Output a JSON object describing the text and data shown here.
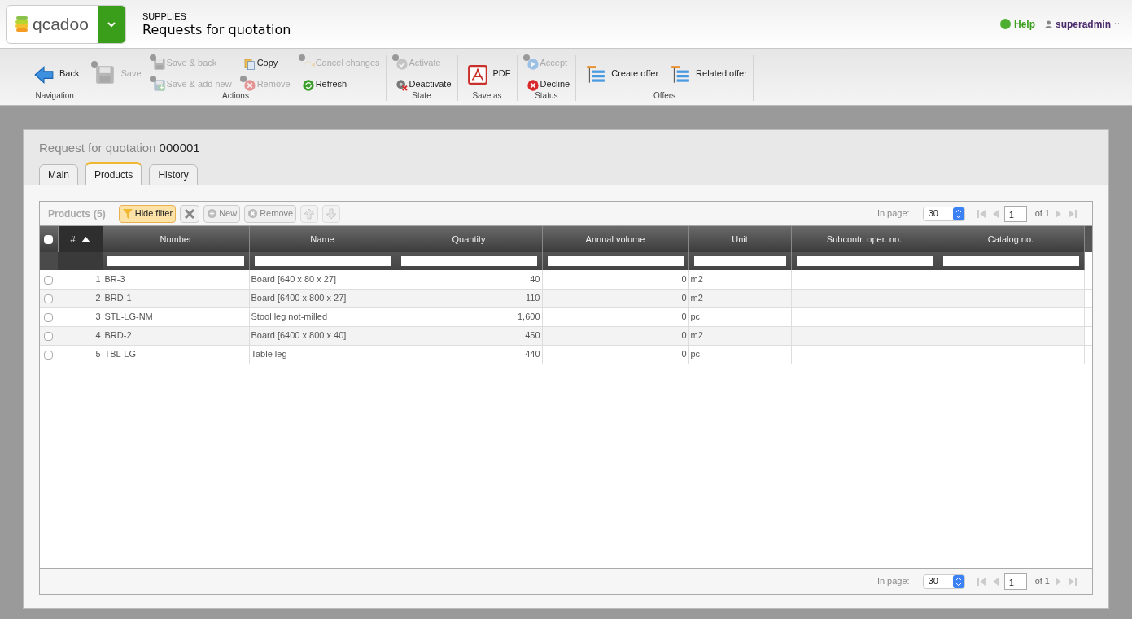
{
  "header": {
    "logo": "qcadoo",
    "module": "SUPPLIES",
    "title": "Requests for quotation",
    "help": "Help",
    "user": "superadmin"
  },
  "ribbon": [
    {
      "label": "Navigation",
      "columns": [
        {
          "kind": "large",
          "items": [
            {
              "label": "Back",
              "disabled": false
            }
          ]
        }
      ]
    },
    {
      "label": "Actions",
      "columns": [
        {
          "kind": "large",
          "items": [
            {
              "label": "Save",
              "disabled": true
            }
          ]
        },
        {
          "kind": "stack",
          "items": [
            {
              "label": "Save & back",
              "disabled": true
            },
            {
              "label": "Save & add new",
              "disabled": true
            }
          ]
        },
        {
          "kind": "stack",
          "items": [
            {
              "label": "Copy",
              "disabled": false
            },
            {
              "label": "Remove",
              "disabled": true
            }
          ]
        },
        {
          "kind": "stack",
          "items": [
            {
              "label": "Cancel changes",
              "disabled": true
            },
            {
              "label": "Refresh",
              "disabled": false
            }
          ]
        }
      ]
    },
    {
      "label": "State",
      "columns": [
        {
          "kind": "stack",
          "items": [
            {
              "label": "Activate",
              "disabled": true
            },
            {
              "label": "Deactivate",
              "disabled": false
            }
          ]
        }
      ]
    },
    {
      "label": "Save as",
      "columns": [
        {
          "kind": "large",
          "items": [
            {
              "label": "PDF",
              "disabled": false
            }
          ]
        }
      ]
    },
    {
      "label": "Status",
      "columns": [
        {
          "kind": "stack",
          "items": [
            {
              "label": "Accept",
              "disabled": true
            },
            {
              "label": "Decline",
              "disabled": false
            }
          ]
        }
      ]
    },
    {
      "label": "Offers",
      "columns": [
        {
          "kind": "large",
          "items": [
            {
              "label": "Create offer",
              "disabled": false
            }
          ]
        },
        {
          "kind": "large",
          "items": [
            {
              "label": "Related offer",
              "disabled": false
            }
          ]
        }
      ]
    }
  ],
  "form": {
    "title": "Request for quotation",
    "number": "000001"
  },
  "tabs": [
    {
      "label": "Main",
      "selected": false
    },
    {
      "label": "Products",
      "selected": true
    },
    {
      "label": "History",
      "selected": false
    }
  ],
  "grid": {
    "title": "Products",
    "count": "(5)",
    "tools": [
      {
        "kind": "filter",
        "label": "Hide filter",
        "selected": true,
        "disabled": false
      },
      {
        "kind": "clear",
        "disabled": false
      },
      {
        "kind": "new",
        "label": "New",
        "disabled": true
      },
      {
        "kind": "remove",
        "label": "Remove",
        "disabled": true
      },
      {
        "kind": "up",
        "disabled": true
      },
      {
        "kind": "down",
        "disabled": true
      }
    ],
    "pager_top": {
      "label": "In page:",
      "size": "30",
      "page": "1",
      "of": "of 1"
    },
    "pager_bottom": {
      "label": "In page:",
      "size": "30",
      "page": "1",
      "of": "of 1"
    },
    "all_checked": false,
    "columns": [
      {
        "label": "#",
        "sorted": true
      },
      {
        "label": "Number",
        "sorted": false
      },
      {
        "label": "Name",
        "sorted": false
      },
      {
        "label": "Quantity",
        "sorted": false
      },
      {
        "label": "Annual volume",
        "sorted": false
      },
      {
        "label": "Unit",
        "sorted": false
      },
      {
        "label": "Subcontr. oper. no.",
        "sorted": false
      },
      {
        "label": "Catalog no.",
        "sorted": false
      }
    ],
    "rows": [
      {
        "checked": false,
        "cells": [
          "1",
          "BR-3",
          "Board [640 x 80 x 27]",
          "40",
          "0",
          "m2",
          "",
          ""
        ]
      },
      {
        "checked": false,
        "cells": [
          "2",
          "BRD-1",
          "Board [6400 x 800 x 27]",
          "110",
          "0",
          "m2",
          "",
          ""
        ]
      },
      {
        "checked": false,
        "cells": [
          "3",
          "STL-LG-NM",
          "Stool leg not-milled",
          "1,600",
          "0",
          "pc",
          "",
          ""
        ]
      },
      {
        "checked": false,
        "cells": [
          "4",
          "BRD-2",
          "Board [6400 x 800 x 40]",
          "450",
          "0",
          "m2",
          "",
          ""
        ]
      },
      {
        "checked": false,
        "cells": [
          "5",
          "TBL-LG",
          "Table leg",
          "440",
          "0",
          "pc",
          "",
          ""
        ]
      }
    ]
  }
}
